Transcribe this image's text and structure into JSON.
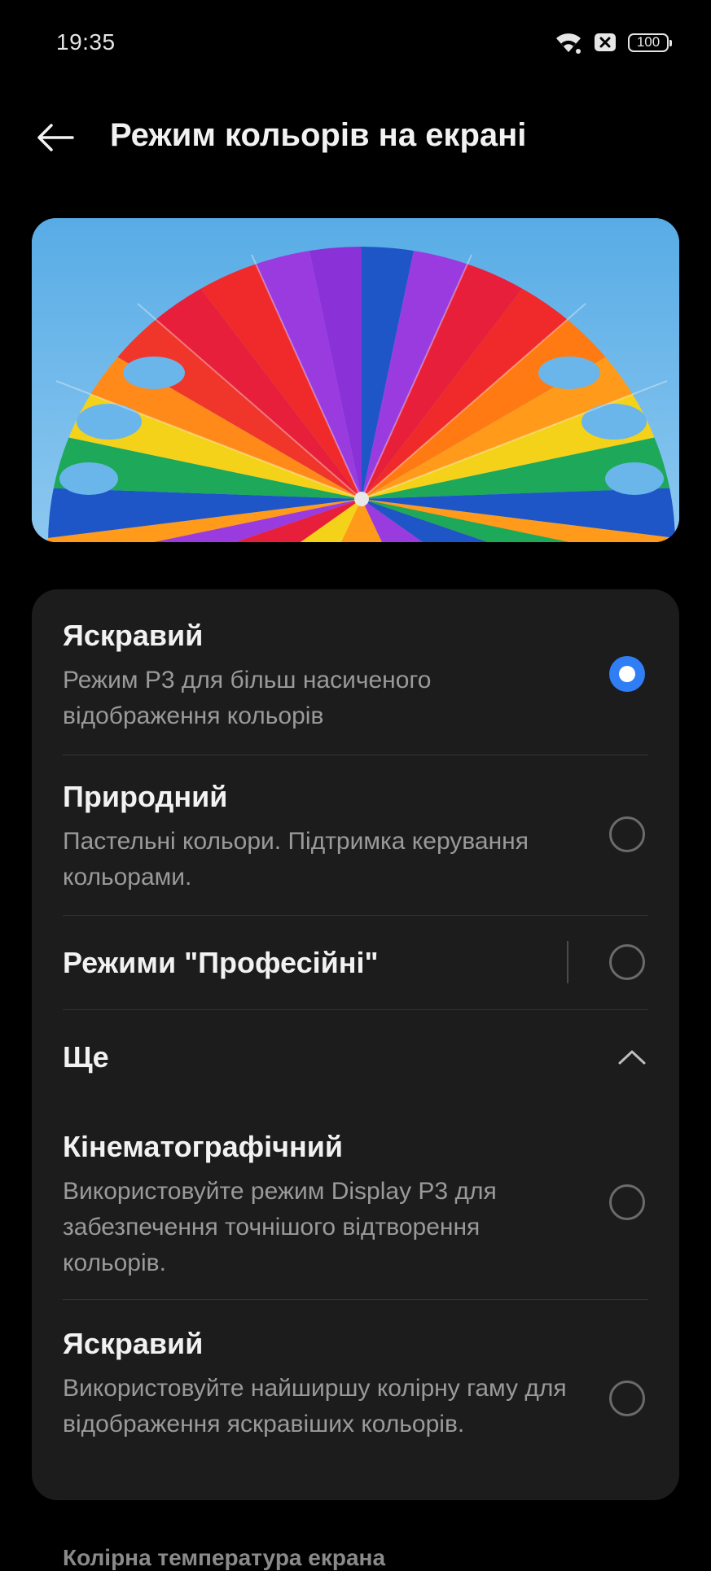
{
  "status_bar": {
    "time": "19:35",
    "battery": "100",
    "icons": [
      "wifi-icon",
      "notification-x-icon",
      "battery-icon"
    ]
  },
  "header": {
    "back_icon": "arrow-left-icon",
    "title": "Режим кольорів на екрані"
  },
  "hero": {
    "image": "colorful-parachute-photo"
  },
  "options": [
    {
      "title": "Яскравий",
      "description": "Режим P3 для більш насиченого відображення кольорів",
      "selected": true
    },
    {
      "title": "Природний",
      "description": "Пастельні кольори. Підтримка керування кольорами.",
      "selected": false
    },
    {
      "title": "Режими \"Професійні\"",
      "selected": false
    }
  ],
  "more_section": {
    "label": "Ще",
    "expanded": true,
    "icon": "chevron-up-icon"
  },
  "more_options": [
    {
      "title": "Кінематографічний",
      "description": "Використовуйте режим Display P3 для забезпечення точнішого відтворення кольорів.",
      "selected": false
    },
    {
      "title": "Яскравий",
      "description": "Використовуйте найширшу колірну гаму для відображення яскравіших кольорів.",
      "selected": false
    }
  ],
  "footer": {
    "next_section_label": "Колірна температура екрана"
  },
  "colors": {
    "accent": "#2f7ef5",
    "card_bg": "#1c1c1c",
    "background": "#000000"
  }
}
